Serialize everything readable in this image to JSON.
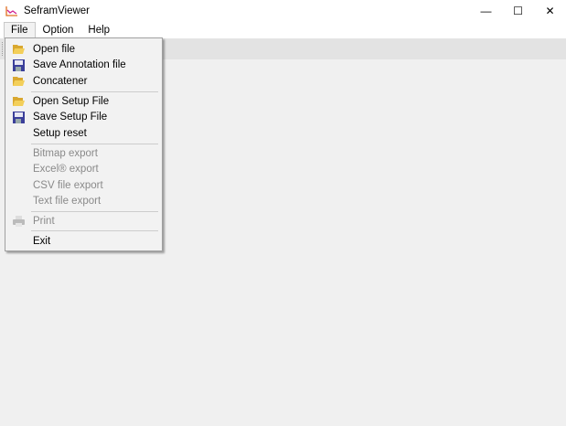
{
  "window": {
    "title": "SeframViewer",
    "minimize": "—",
    "maximize": "☐",
    "close": "✕"
  },
  "menubar": [
    "File",
    "Option",
    "Help"
  ],
  "file_menu": {
    "group1": [
      {
        "label": "Open file",
        "icon": "folder-open-icon"
      },
      {
        "label": "Save Annotation file",
        "icon": "floppy-disk-icon"
      },
      {
        "label": "Concatener",
        "icon": "folder-open-icon"
      }
    ],
    "group2": [
      {
        "label": "Open Setup File",
        "icon": "folder-open-icon"
      },
      {
        "label": "Save Setup File",
        "icon": "floppy-disk-icon"
      },
      {
        "label": "Setup reset"
      }
    ],
    "group3": [
      {
        "label": "Bitmap export"
      },
      {
        "label": "Excel® export"
      },
      {
        "label": "CSV file export"
      },
      {
        "label": "Text file export"
      }
    ],
    "print": {
      "label": "Print",
      "icon": "printer-icon"
    },
    "exit": {
      "label": "Exit"
    }
  }
}
